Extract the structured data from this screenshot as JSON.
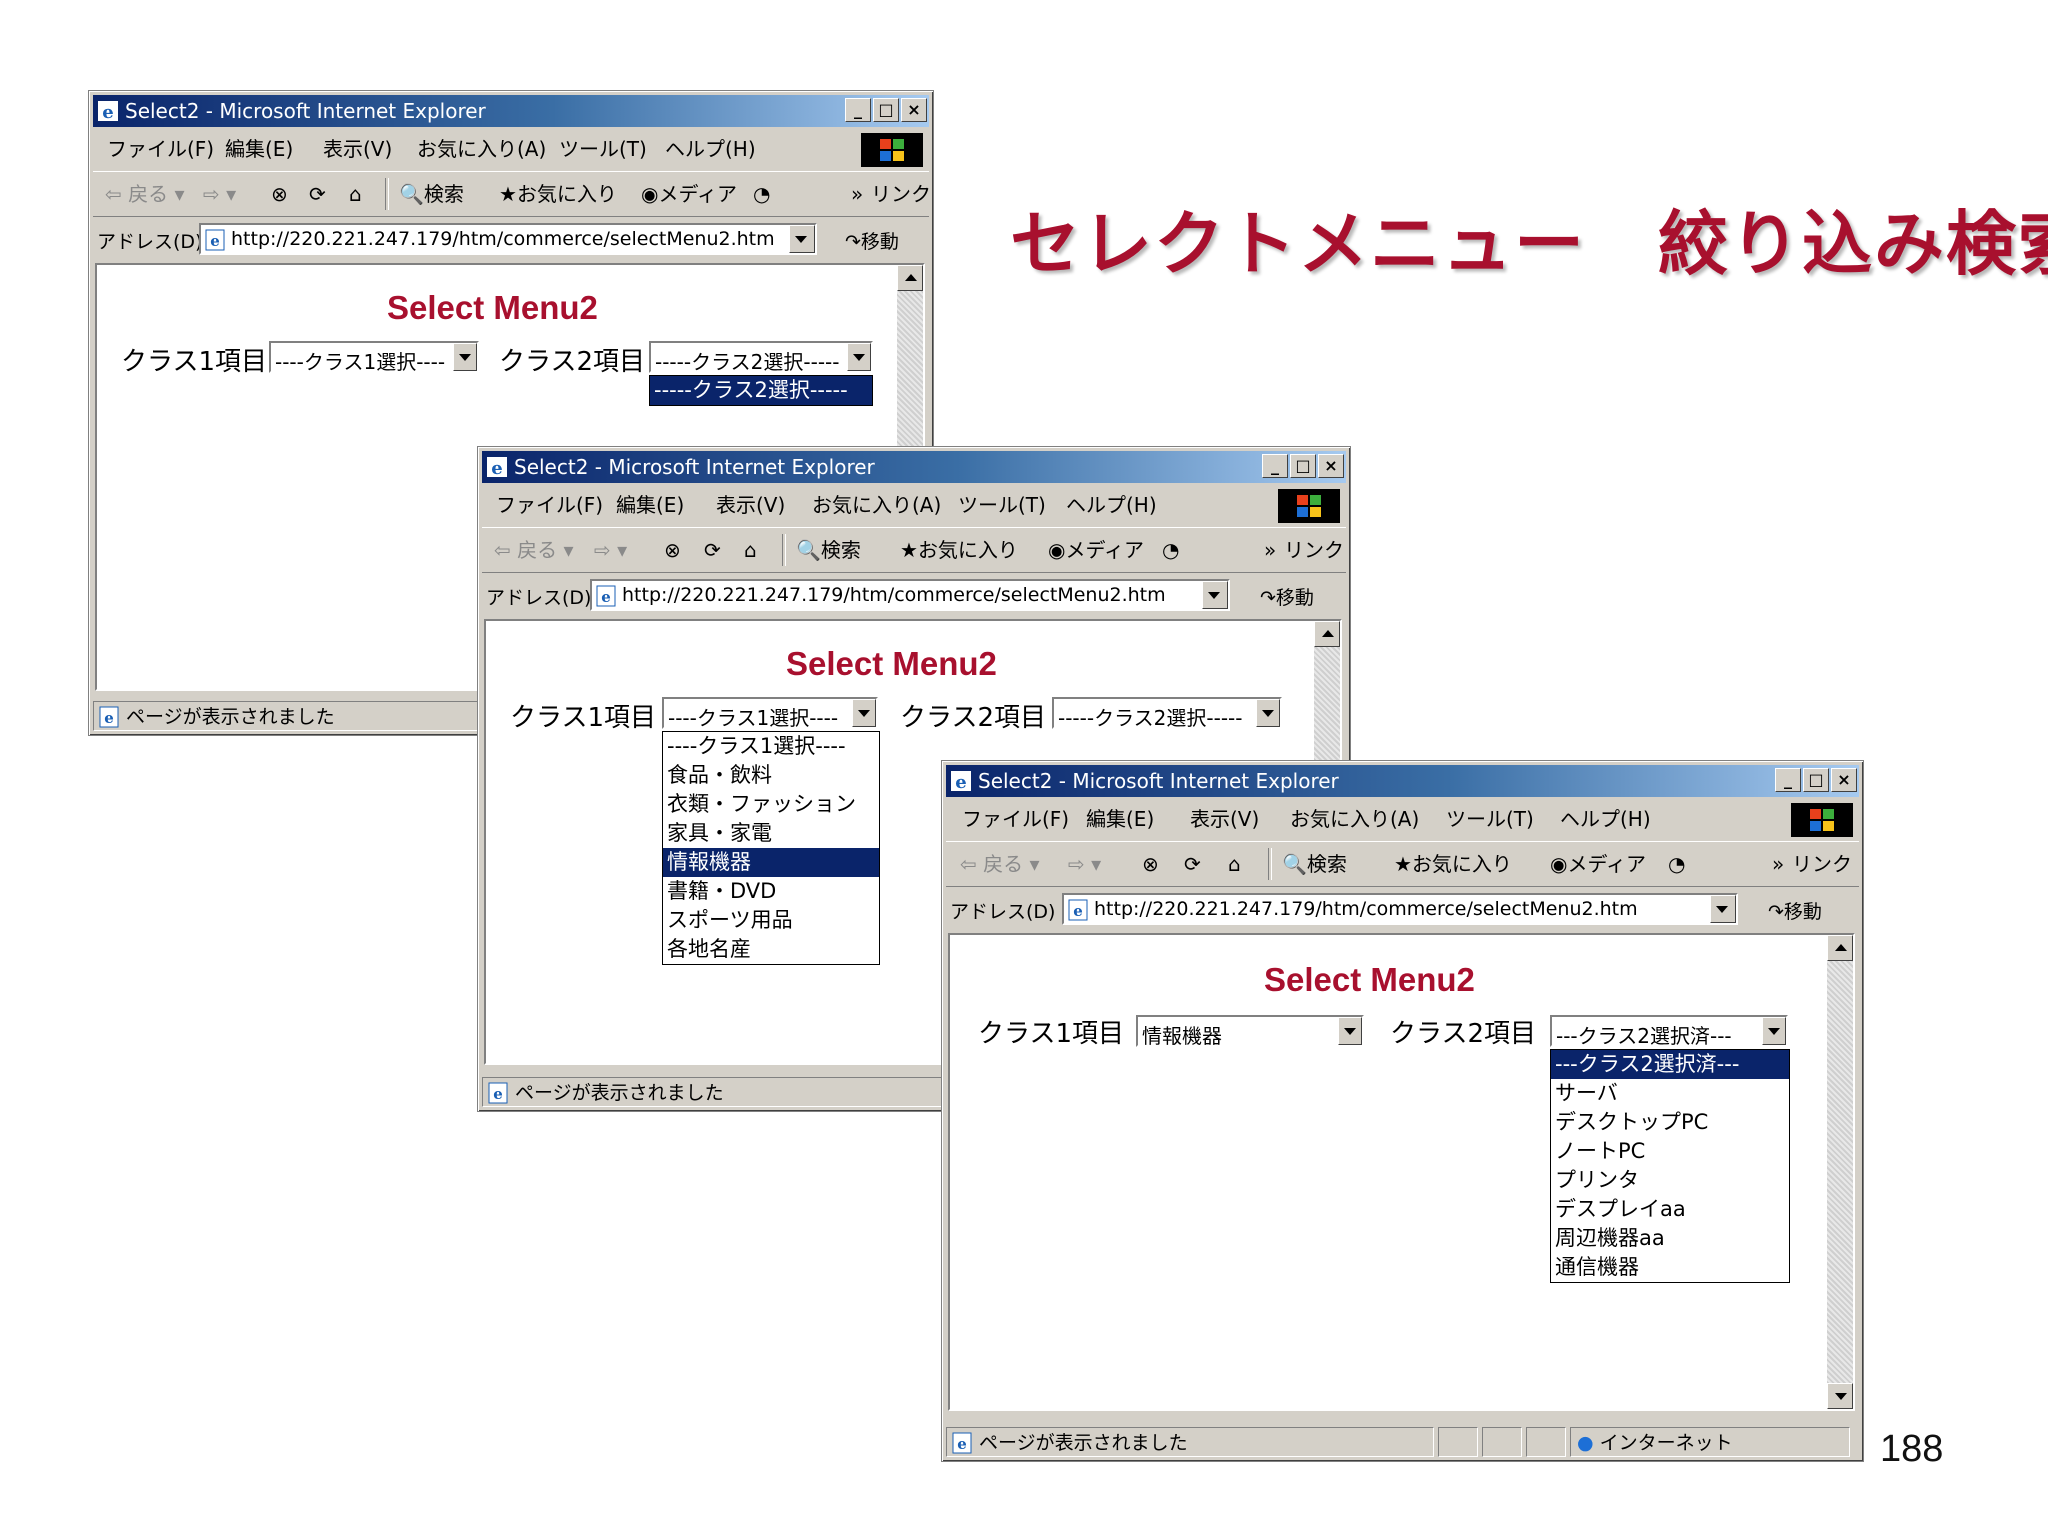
{
  "slide": {
    "title": "セレクトメニュー　絞り込み検索",
    "page_number": "188"
  },
  "browser": {
    "window_title": "Select2 - Microsoft Internet Explorer",
    "menu": [
      "ファイル(F)",
      "編集(E)",
      "表示(V)",
      "お気に入り(A)",
      "ツール(T)",
      "ヘルプ(H)"
    ],
    "toolbar": {
      "back": "戻る",
      "search": "検索",
      "favorites": "お気に入り",
      "media": "メディア",
      "links_chevron": "»",
      "links": "リンク"
    },
    "address_label": "アドレス(D)",
    "url": "http://220.221.247.179/htm/commerce/selectMenu2.htm",
    "go": "移動",
    "status_text": "ページが表示されました",
    "zone_text": "インターネット"
  },
  "page": {
    "heading": "Select Menu2",
    "class1_label": "クラス1項目",
    "class2_label": "クラス2項目"
  },
  "window1": {
    "class1_value": "----クラス1選択----",
    "class2_value": "-----クラス2選択-----",
    "class2_options": [
      "-----クラス2選択-----"
    ]
  },
  "window2": {
    "class1_value": "----クラス1選択----",
    "class2_value": "-----クラス2選択-----",
    "class1_options": [
      "----クラス1選択----",
      "食品・飲料",
      "衣類・ファッション",
      "家具・家電",
      "情報機器",
      "書籍・DVD",
      "スポーツ用品",
      "各地名産"
    ],
    "class1_highlighted": "情報機器"
  },
  "window3": {
    "class1_value": "情報機器",
    "class2_value": "---クラス2選択済---",
    "class2_options": [
      "---クラス2選択済---",
      "サーバ",
      "デスクトップPC",
      "ノートPC",
      "プリンタ",
      "デスプレイaa",
      "周辺機器aa",
      "通信機器"
    ],
    "class2_highlighted": "---クラス2選択済---"
  },
  "colors": {
    "title_red": "#a8102e",
    "titlebar_start": "#0a246a",
    "titlebar_end": "#a6caf0",
    "selection": "#0a246a"
  }
}
